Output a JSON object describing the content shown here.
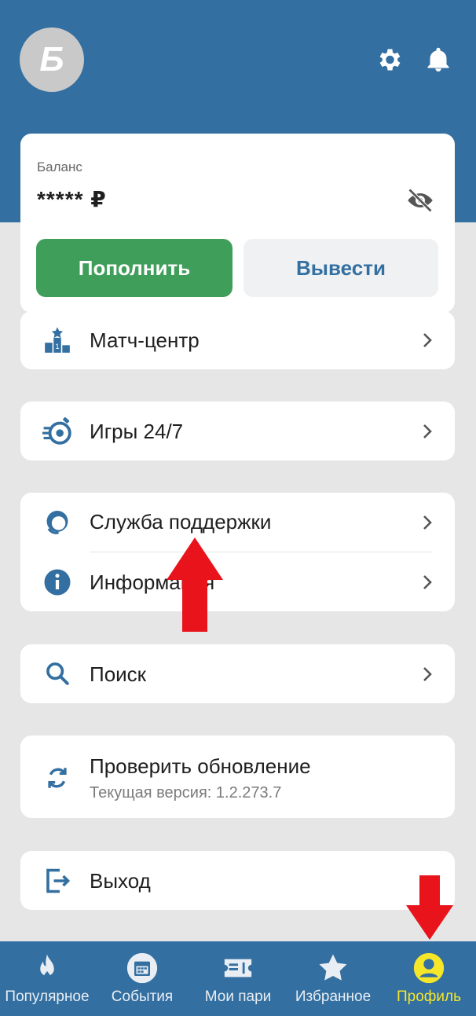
{
  "header": {
    "avatar_letter": "Б",
    "icons": [
      "gear-icon",
      "bell-icon"
    ]
  },
  "balance": {
    "label": "Баланс",
    "value": "***** ₽",
    "topup_label": "Пополнить",
    "withdraw_label": "Вывести"
  },
  "menu": {
    "match_center": "Матч-центр",
    "games": "Игры 24/7",
    "support": "Служба поддержки",
    "info": "Информация",
    "search": "Поиск",
    "update_title": "Проверить обновление",
    "update_version": "Текущая версия: 1.2.273.7",
    "logout": "Выход"
  },
  "tabs": [
    {
      "label": "Популярное",
      "icon": "flame-icon"
    },
    {
      "label": "События",
      "icon": "calendar-icon"
    },
    {
      "label": "Мои пари",
      "icon": "ticket-icon"
    },
    {
      "label": "Избранное",
      "icon": "star-icon"
    },
    {
      "label": "Профиль",
      "icon": "profile-icon",
      "active": true
    }
  ],
  "colors": {
    "brand_blue": "#336fa0",
    "topup_green": "#3f9e5a",
    "active_tab": "#f6e62a",
    "annotation_arrow": "#e8131b"
  }
}
